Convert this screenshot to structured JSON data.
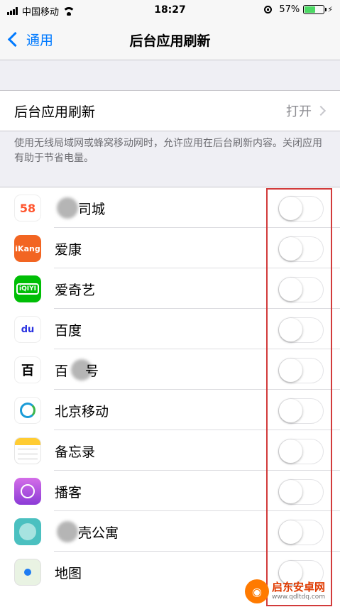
{
  "status_bar": {
    "carrier": "中国移动",
    "time": "18:27",
    "battery_percent": "57%",
    "battery_level": 0.57
  },
  "nav": {
    "back_label": "通用",
    "title": "后台应用刷新"
  },
  "master": {
    "label": "后台应用刷新",
    "value": "打开"
  },
  "footnote": "使用无线局域网或蜂窝移动网时，允许应用在后台刷新内容。关闭应用有助于节省电量。",
  "apps": [
    {
      "name": "司城",
      "icon": "58-tongcheng-icon",
      "icon_text": "58",
      "color": "#ffffff",
      "blurred_prefix": true,
      "enabled": false
    },
    {
      "name": "爱康",
      "icon": "ikang-icon",
      "icon_text": "iKang",
      "color": "#f26522",
      "blurred_prefix": false,
      "enabled": false
    },
    {
      "name": "爱奇艺",
      "icon": "iqiyi-icon",
      "icon_text": "iQIYI",
      "color": "#00be06",
      "blurred_prefix": false,
      "enabled": false
    },
    {
      "name": "百度",
      "icon": "baidu-paw-icon",
      "icon_text": "du",
      "color": "#ffffff",
      "blurred_prefix": false,
      "enabled": false
    },
    {
      "name": "百",
      "name_suffix": "号",
      "icon": "baijiahao-icon",
      "icon_text": "百",
      "color": "#ffffff",
      "blurred_mid": true,
      "enabled": false
    },
    {
      "name": "北京移动",
      "icon": "china-mobile-icon",
      "icon_text": "",
      "color": "#ffffff",
      "blurred_prefix": false,
      "enabled": false
    },
    {
      "name": "备忘录",
      "icon": "notes-icon",
      "icon_text": "",
      "color": "#ffffff",
      "blurred_prefix": false,
      "enabled": false
    },
    {
      "name": "播客",
      "icon": "podcasts-icon",
      "icon_text": "",
      "color": "#a64dd6",
      "blurred_prefix": false,
      "enabled": false
    },
    {
      "name": "壳公寓",
      "icon": "danke-apartment-icon",
      "icon_text": "",
      "color": "#4bc0c0",
      "blurred_prefix": true,
      "enabled": false
    },
    {
      "name": "地图",
      "icon": "maps-icon",
      "icon_text": "",
      "color": "#e9f3e3",
      "blurred_prefix": false,
      "enabled": false
    }
  ],
  "watermark": {
    "title": "启东安卓网",
    "url": "www.qdltdq.com"
  }
}
